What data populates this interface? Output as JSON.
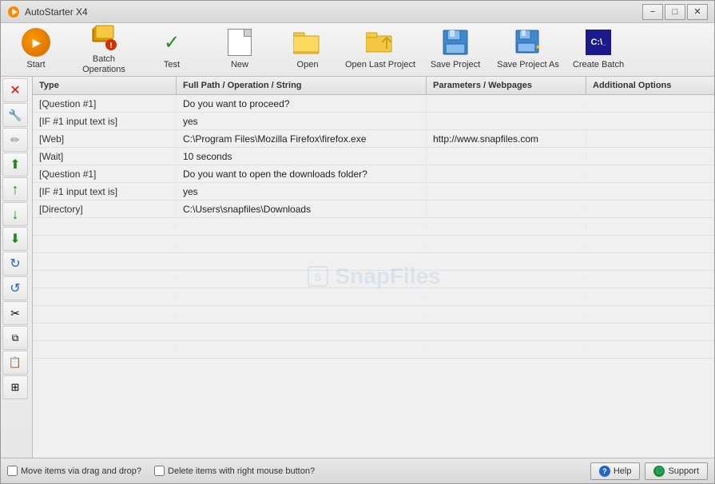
{
  "window": {
    "title": "AutoStarter X4",
    "min_label": "−",
    "max_label": "□",
    "close_label": "✕"
  },
  "toolbar": {
    "buttons": [
      {
        "id": "start",
        "label": "Start"
      },
      {
        "id": "batch-operations",
        "label": "Batch Operations"
      },
      {
        "id": "test",
        "label": "Test"
      },
      {
        "id": "new",
        "label": "New"
      },
      {
        "id": "open",
        "label": "Open"
      },
      {
        "id": "open-last",
        "label": "Open Last Project"
      },
      {
        "id": "save",
        "label": "Save Project"
      },
      {
        "id": "save-as",
        "label": "Save Project As"
      },
      {
        "id": "create-batch",
        "label": "Create Batch"
      }
    ]
  },
  "table": {
    "headers": [
      "Type",
      "Full Path / Operation / String",
      "Parameters / Webpages",
      "Additional Options"
    ],
    "rows": [
      {
        "type": "[Question #1]",
        "operation": "Do you want to proceed?",
        "params": "",
        "options": ""
      },
      {
        "type": "[IF #1 input text is]",
        "operation": "yes",
        "params": "",
        "options": ""
      },
      {
        "type": "[Web]",
        "operation": "C:\\Program Files\\Mozilla Firefox\\firefox.exe",
        "params": "http://www.snapfiles.com",
        "options": ""
      },
      {
        "type": "[Wait]",
        "operation": "10 seconds",
        "params": "",
        "options": ""
      },
      {
        "type": "[Question #1]",
        "operation": "Do you want to open the downloads folder?",
        "params": "",
        "options": ""
      },
      {
        "type": "[IF #1 input text is]",
        "operation": "yes",
        "params": "",
        "options": ""
      },
      {
        "type": "[Directory]",
        "operation": "C:\\Users\\snapfiles\\Downloads",
        "params": "",
        "options": ""
      }
    ]
  },
  "left_toolbar": {
    "buttons": [
      {
        "id": "delete",
        "icon": "✕",
        "color": "red"
      },
      {
        "id": "wrench",
        "icon": "🔧",
        "color": "gray"
      },
      {
        "id": "edit",
        "icon": "✏",
        "color": "gray"
      },
      {
        "id": "move-top",
        "icon": "⬆",
        "color": "green"
      },
      {
        "id": "move-up",
        "icon": "↑",
        "color": "green"
      },
      {
        "id": "move-down",
        "icon": "↓",
        "color": "green"
      },
      {
        "id": "move-bottom",
        "icon": "⬇",
        "color": "green"
      },
      {
        "id": "rotate-right",
        "icon": "↻",
        "color": "blue"
      },
      {
        "id": "rotate-left",
        "icon": "↺",
        "color": "blue"
      },
      {
        "id": "cut",
        "icon": "✂",
        "color": "gray"
      },
      {
        "id": "copy",
        "icon": "⧉",
        "color": "gray"
      },
      {
        "id": "paste",
        "icon": "📋",
        "color": "gray"
      },
      {
        "id": "duplicate",
        "icon": "⊞",
        "color": "gray"
      }
    ]
  },
  "status_bar": {
    "checkbox1_label": "Move items via drag and drop?",
    "checkbox2_label": "Delete items with right mouse button?",
    "help_label": "Help",
    "support_label": "Support"
  },
  "watermark": {
    "text": "SnapFiles"
  }
}
